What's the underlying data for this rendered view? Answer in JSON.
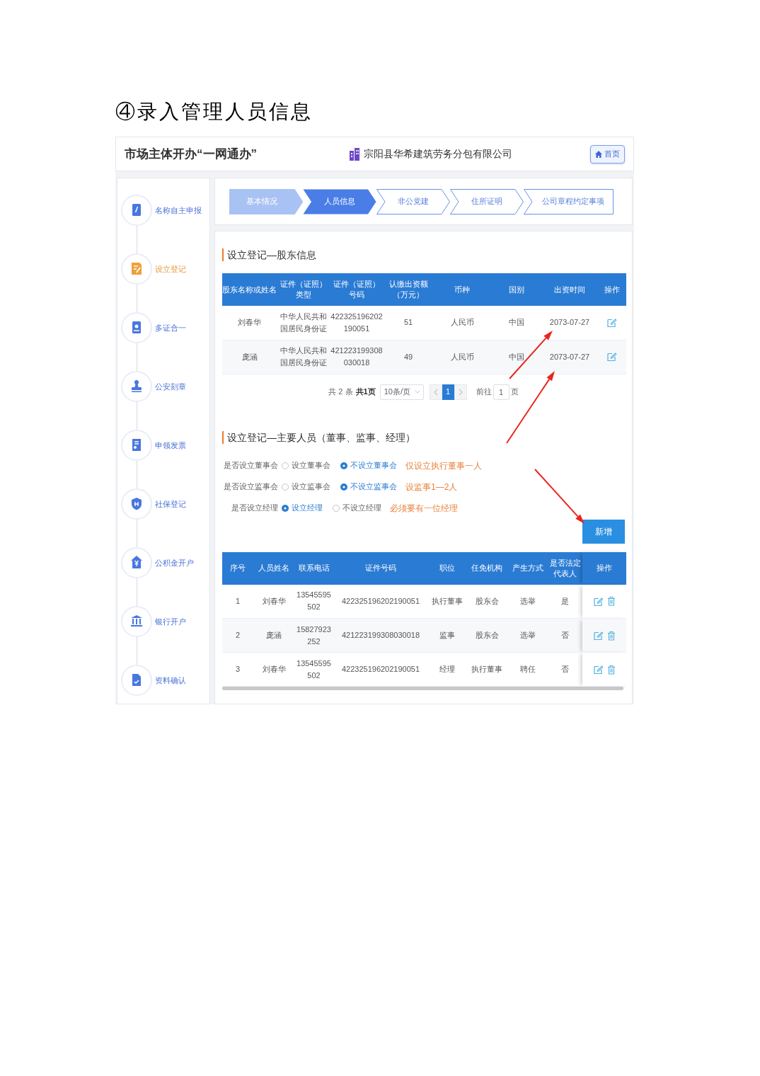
{
  "heading": "④录入管理人员信息",
  "app_header": {
    "title": "市场主体开办“一网通办”",
    "company": "宗阳县华希建筑劳务分包有限公司",
    "home_button": "首页"
  },
  "sidebar": {
    "items": [
      {
        "label": "名称自主申报",
        "selected": false
      },
      {
        "label": "设立登记",
        "selected": true
      },
      {
        "label": "多证合一",
        "selected": false
      },
      {
        "label": "公安刻章",
        "selected": false
      },
      {
        "label": "申领发票",
        "selected": false
      },
      {
        "label": "社保登记",
        "selected": false
      },
      {
        "label": "公积金开户",
        "selected": false
      },
      {
        "label": "银行开户",
        "selected": false
      },
      {
        "label": "资料确认",
        "selected": false
      }
    ]
  },
  "steps": [
    {
      "label": "基本情况",
      "completed": true,
      "selected": false
    },
    {
      "label": "人员信息",
      "completed": false,
      "selected": true
    },
    {
      "label": "非公党建",
      "completed": false,
      "selected": false
    },
    {
      "label": "住所证明",
      "completed": false,
      "selected": false
    },
    {
      "label": "公司章程约定事项",
      "completed": false,
      "selected": false
    }
  ],
  "shareholders": {
    "title": "设立登记—股东信息",
    "columns": [
      "股东名称或姓名",
      "证件（证照）类型",
      "证件（证照）号码",
      "认缴出资额（万元）",
      "币种",
      "国别",
      "出资时间",
      "操作"
    ],
    "rows": [
      [
        "刘春华",
        "中华人民共和国居民身份证",
        "422325196202190051",
        "51",
        "人民币",
        "中国",
        "2073-07-27"
      ],
      [
        "庞涵",
        "中华人民共和国居民身份证",
        "421223199308030018",
        "49",
        "人民币",
        "中国",
        "2073-07-27"
      ]
    ],
    "pagination": {
      "total": "共 2 条",
      "page_count": "共1页",
      "page_size": "10条/页",
      "pages": [
        {
          "label": "1",
          "selected": true
        }
      ],
      "goto_label": "前往",
      "goto_value": "1",
      "goto_unit": "页"
    }
  },
  "officers": {
    "title": "设立登记—主要人员（董事、监事、经理）",
    "questions": [
      {
        "label": "是否设立董事会",
        "options": [
          {
            "label": "设立董事会",
            "selected": false
          },
          {
            "label": "不设立董事会",
            "selected": true
          }
        ],
        "hint": "仅设立执行董事一人"
      },
      {
        "label": "是否设立监事会",
        "options": [
          {
            "label": "设立监事会",
            "selected": false
          },
          {
            "label": "不设立监事会",
            "selected": true
          }
        ],
        "hint": "设监事1—2人"
      },
      {
        "label": "是否设立经理",
        "options": [
          {
            "label": "设立经理",
            "selected": true
          },
          {
            "label": "不设立经理",
            "selected": false
          }
        ],
        "hint": "必须要有一位经理"
      }
    ],
    "add_button": "新增",
    "table": {
      "columns": [
        "序号",
        "人员姓名",
        "联系电话",
        "证件号码",
        "职位",
        "任免机构",
        "产生方式",
        "是否法定代表人",
        "操作"
      ],
      "rows": [
        [
          "1",
          "刘春华",
          "13545595502",
          "422325196202190051",
          "执行董事",
          "股东会",
          "选举",
          "是"
        ],
        [
          "2",
          "庞涵",
          "15827923252",
          "421223199308030018",
          "监事",
          "股东会",
          "选举",
          "否"
        ],
        [
          "3",
          "刘春华",
          "13545595502",
          "422325196202190051",
          "经理",
          "执行董事",
          "聘任",
          "否"
        ]
      ]
    }
  }
}
